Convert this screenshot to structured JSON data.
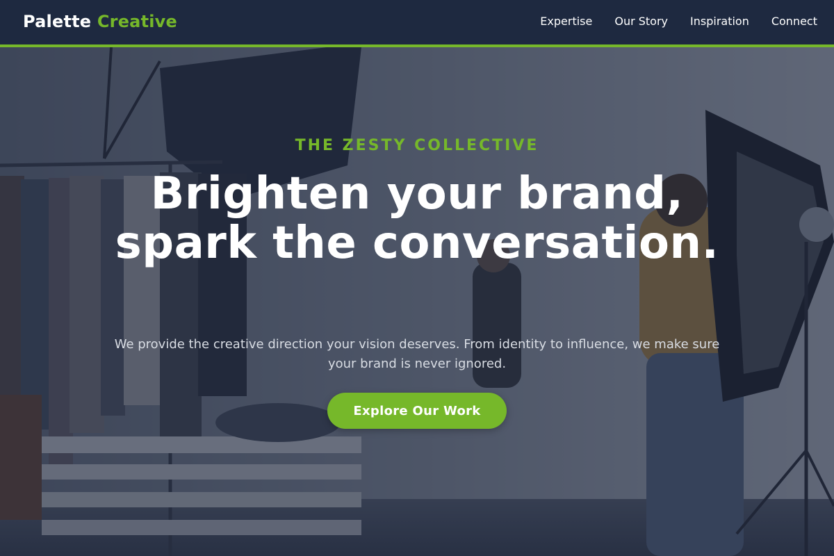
{
  "header": {
    "brand_primary": "Palette",
    "brand_accent": "Creative",
    "nav": [
      {
        "label": "Expertise"
      },
      {
        "label": "Our Story"
      },
      {
        "label": "Inspiration"
      },
      {
        "label": "Connect"
      }
    ]
  },
  "hero": {
    "eyebrow": "THE ZESTY COLLECTIVE",
    "headline": "Brighten your brand, spark the conversation.",
    "lede": "We provide the creative direction your vision deserves. From identity to influence, we make sure your brand is never ignored.",
    "cta_label": "Explore Our Work",
    "photo_subject": "photo studio shoot with clothing rack, umbrella lights and a photographer"
  },
  "colors": {
    "accent": "#76b82a",
    "header_bg": "#1e2940",
    "overlay": "#182137",
    "text_light": "#ffffff",
    "text_muted": "#d9dde4"
  }
}
